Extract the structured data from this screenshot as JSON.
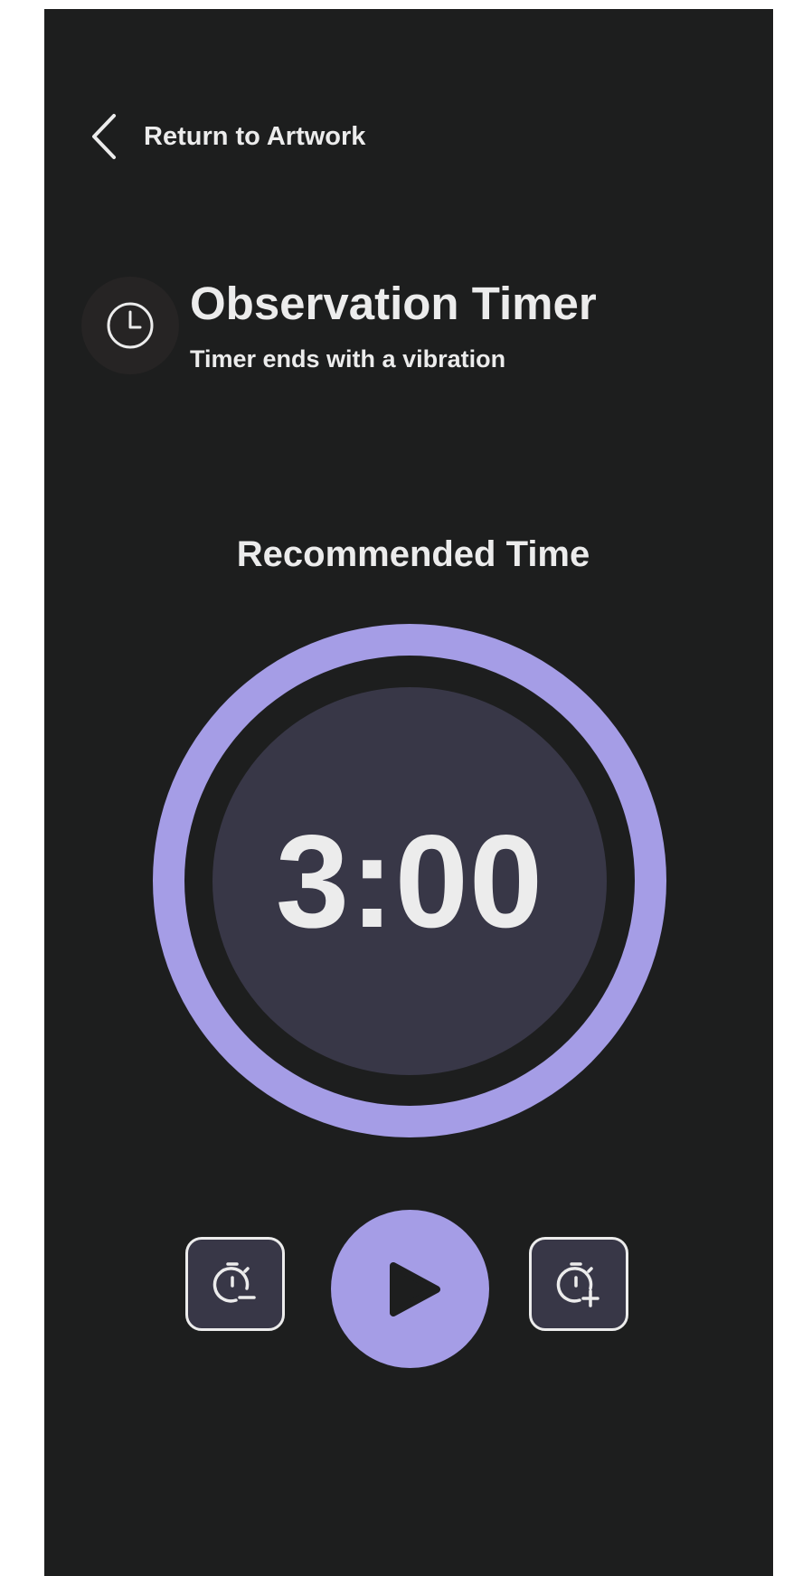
{
  "nav": {
    "back_label": "Return to Artwork",
    "back_icon": "chevron-left-icon"
  },
  "header": {
    "icon": "clock-icon",
    "title": "Observation Timer",
    "subtitle": "Timer ends with a vibration"
  },
  "timer": {
    "section_label": "Recommended Time",
    "time": "3:00",
    "progress": 1.0
  },
  "controls": {
    "decrease_icon": "stopwatch-minus-icon",
    "play_icon": "play-icon",
    "increase_icon": "stopwatch-plus-icon"
  },
  "colors": {
    "background": "#1d1e1e",
    "accent": "#a59de6",
    "dial": "#383747",
    "text": "#ececec",
    "icon_badge": "#262424"
  }
}
